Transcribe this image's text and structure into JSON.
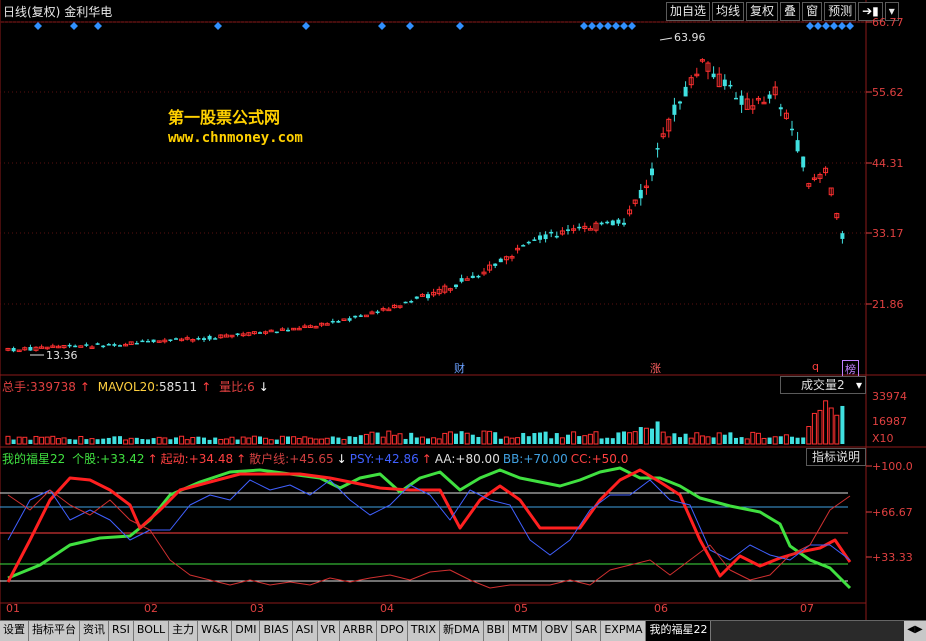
{
  "title": {
    "period": "日线(复权)",
    "stock": "金利华电"
  },
  "toolbar": [
    "加自选",
    "均线",
    "复权",
    "叠",
    "窗",
    "预测"
  ],
  "price_axis": [
    "66.77",
    "55.62",
    "44.31",
    "33.17",
    "21.86"
  ],
  "annotations": {
    "high": "63.96",
    "low": "13.36"
  },
  "watermark": {
    "line1": "第一股票公式网",
    "line2": "www.chnmoney.com"
  },
  "event_tags": [
    {
      "text": "财",
      "color": "#6aa0ff"
    },
    {
      "text": "涨",
      "color": "#ff6060"
    },
    {
      "text": "q",
      "color": "#ff4040"
    },
    {
      "text": "榜",
      "color": "#c080ff"
    }
  ],
  "volume_panel": {
    "total_label": "总手:",
    "total_value": "339738",
    "mavol_label": "MAVOL20:",
    "mavol_value": "58511",
    "ratio_label": "量比:",
    "ratio_value": "6",
    "dropdown": "成交量2",
    "axis": [
      "33974",
      "16987",
      "X10"
    ]
  },
  "indicator_panel": {
    "name": "我的福星22",
    "items": [
      {
        "label": "个股:",
        "value": "+33.42",
        "color": "#40e040",
        "arrow": "↑",
        "arrow_color": "#ff4040"
      },
      {
        "label": "起动:",
        "value": "+34.48",
        "color": "#ff4040",
        "arrow": "↑",
        "arrow_color": "#ff4040"
      },
      {
        "label": "散户线:",
        "value": "+45.65",
        "color": "#d04040",
        "arrow": "↓",
        "arrow_color": "#ffffff"
      },
      {
        "label": "PSY:",
        "value": "+42.86",
        "color": "#4060ff",
        "arrow": "↑",
        "arrow_color": "#ff4040"
      },
      {
        "label": "AA:",
        "value": "+80.00",
        "color": "#e0e0e0",
        "arrow": "",
        "arrow_color": ""
      },
      {
        "label": "BB:",
        "value": "+70.00",
        "color": "#40a0e0",
        "arrow": "",
        "arrow_color": ""
      },
      {
        "label": "CC:",
        "value": "+50.0",
        "color": "#ff4040",
        "arrow": "",
        "arrow_color": ""
      }
    ],
    "button": "指标说明",
    "axis": [
      "+100.0",
      "+66.67",
      "+33.33"
    ]
  },
  "months": [
    "01",
    "02",
    "03",
    "04",
    "05",
    "06",
    "07"
  ],
  "tabs": [
    "设置",
    "指标平台",
    "资讯",
    "RSI",
    "BOLL",
    "主力",
    "W&R",
    "DMI",
    "BIAS",
    "ASI",
    "VR",
    "ARBR",
    "DPO",
    "TRIX",
    "新DMA",
    "BBI",
    "MTM",
    "OBV",
    "SAR",
    "EXPMA",
    "我的福星22"
  ],
  "active_tab": "我的福星22",
  "colors": {
    "up": "#ff3030",
    "down": "#40e0e0",
    "grid": "#8b1a1a",
    "signal": "#3090ff"
  }
}
